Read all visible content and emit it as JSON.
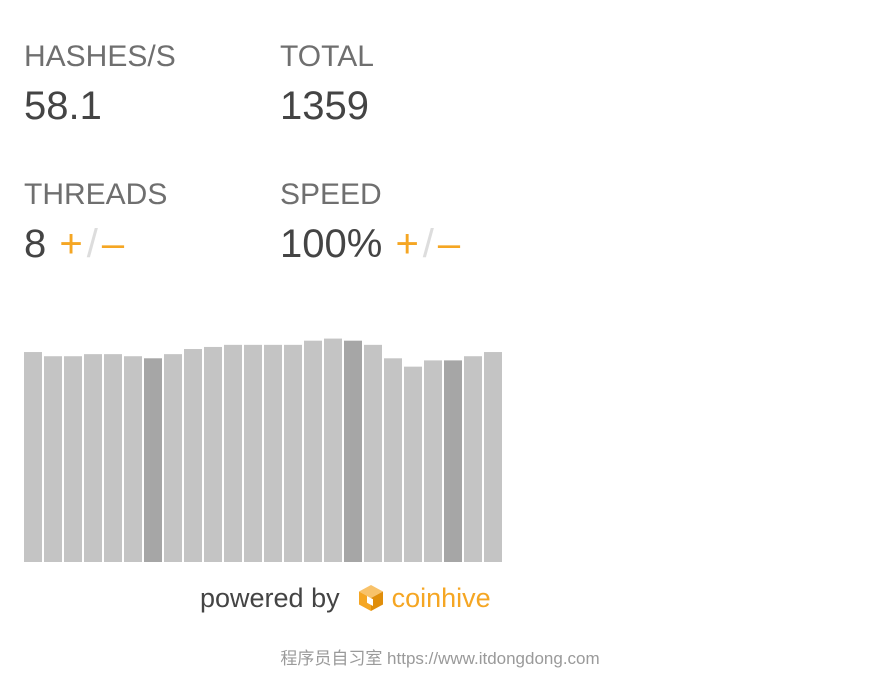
{
  "stats": {
    "hashes": {
      "label": "HASHES/S",
      "value": "58.1"
    },
    "total": {
      "label": "TOTAL",
      "value": "1359"
    },
    "threads": {
      "label": "THREADS",
      "value": "8",
      "plus": "+",
      "separator": "/",
      "minus": "–"
    },
    "speed": {
      "label": "SPEED",
      "value": "100%",
      "plus": "+",
      "separator": "/",
      "minus": "–"
    }
  },
  "chart_data": {
    "type": "bar",
    "values": [
      0.905,
      0.887,
      0.887,
      0.896,
      0.896,
      0.887,
      0.878,
      0.896,
      0.918,
      0.927,
      0.936,
      0.936,
      0.936,
      0.936,
      0.954,
      0.963,
      0.954,
      0.936,
      0.878,
      0.842,
      0.869,
      0.869,
      0.887,
      0.905
    ],
    "highlighted": [
      6,
      16,
      21
    ],
    "ylim": [
      0,
      1
    ],
    "bar_color": "#c4c4c4",
    "highlight_color": "#a6a6a6"
  },
  "powered": {
    "text": "powered by",
    "brand": "coinhive",
    "brand_icon": "coinhive-cube-icon",
    "brand_color": "#f5a623"
  },
  "footer": {
    "text": "程序员自习室 https://www.itdongdong.com"
  }
}
